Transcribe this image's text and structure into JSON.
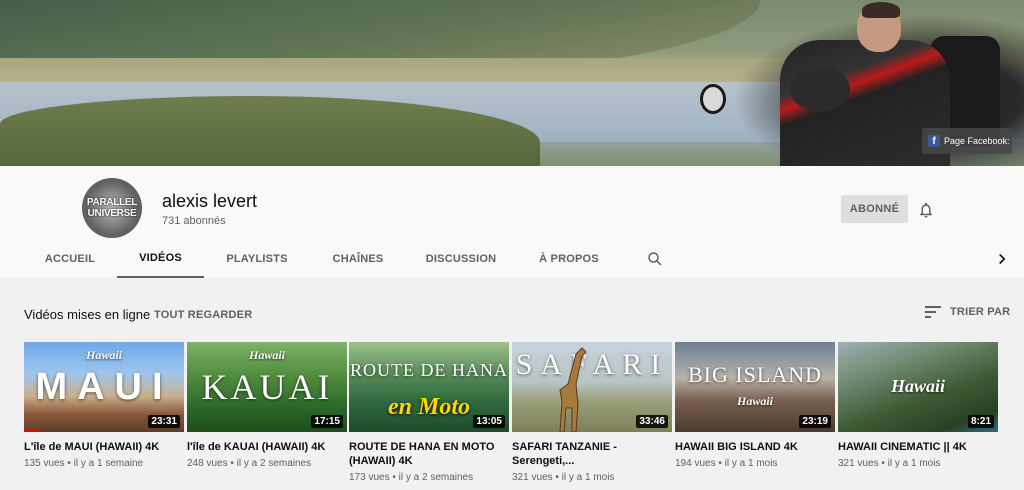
{
  "banner": {
    "facebook_link": "Page Facebook:"
  },
  "channel": {
    "avatar_text": [
      "PARALLEL",
      "UNIVERSE"
    ],
    "name": "alexis levert",
    "subscribers": "731 abonnés",
    "subscribe_label": "ABONNÉ"
  },
  "tabs": [
    {
      "label": "ACCUEIL"
    },
    {
      "label": "VIDÉOS"
    },
    {
      "label": "PLAYLISTS"
    },
    {
      "label": "CHAÎNES"
    },
    {
      "label": "DISCUSSION"
    },
    {
      "label": "À PROPOS"
    }
  ],
  "section": {
    "title": "Vidéos mises en ligne",
    "see_all": "TOUT REGARDER",
    "sort_label": "TRIER PAR"
  },
  "videos": [
    {
      "thumb_big": "MAUI",
      "thumb_script": "Hawaii",
      "duration": "23:31",
      "watch_progress": 0.1,
      "title": "L'île de MAUI (HAWAII) 4K",
      "meta": "135 vues • il y a 1 semaine"
    },
    {
      "thumb_big": "KAUAI",
      "thumb_script": "Hawaii",
      "duration": "17:15",
      "title": "l'île de KAUAI (HAWAII) 4K",
      "meta": "248 vues • il y a 2 semaines"
    },
    {
      "thumb_big": "ROUTE DE HANA",
      "thumb_script": "en Moto",
      "duration": "13:05",
      "title": "ROUTE DE HANA EN MOTO (HAWAII) 4K",
      "meta": "173 vues • il y a 2 semaines"
    },
    {
      "thumb_big": "SAFARI",
      "thumb_script": "",
      "duration": "33:46",
      "title": "SAFARI TANZANIE - Serengeti,...",
      "meta": "321 vues • il y a 1 mois"
    },
    {
      "thumb_big": "BIG ISLAND",
      "thumb_script": "Hawaii",
      "duration": "23:19",
      "title": "HAWAII BIG ISLAND 4K",
      "meta": "194 vues • il y a 1 mois"
    },
    {
      "thumb_big": "",
      "thumb_script": "Hawaii",
      "duration": "8:21",
      "title": "HAWAII CINEMATIC || 4K",
      "meta": "321 vues • il y a 1 mois"
    }
  ],
  "colors": {
    "active_tab_underline": "#606060",
    "progress_bar": "#ee0000",
    "facebook_blue": "#3b5998"
  },
  "icons": {
    "bell": "bell-icon",
    "search": "search-icon",
    "next": "chevron-right-icon",
    "sort": "sort-icon",
    "facebook": "facebook-icon"
  }
}
